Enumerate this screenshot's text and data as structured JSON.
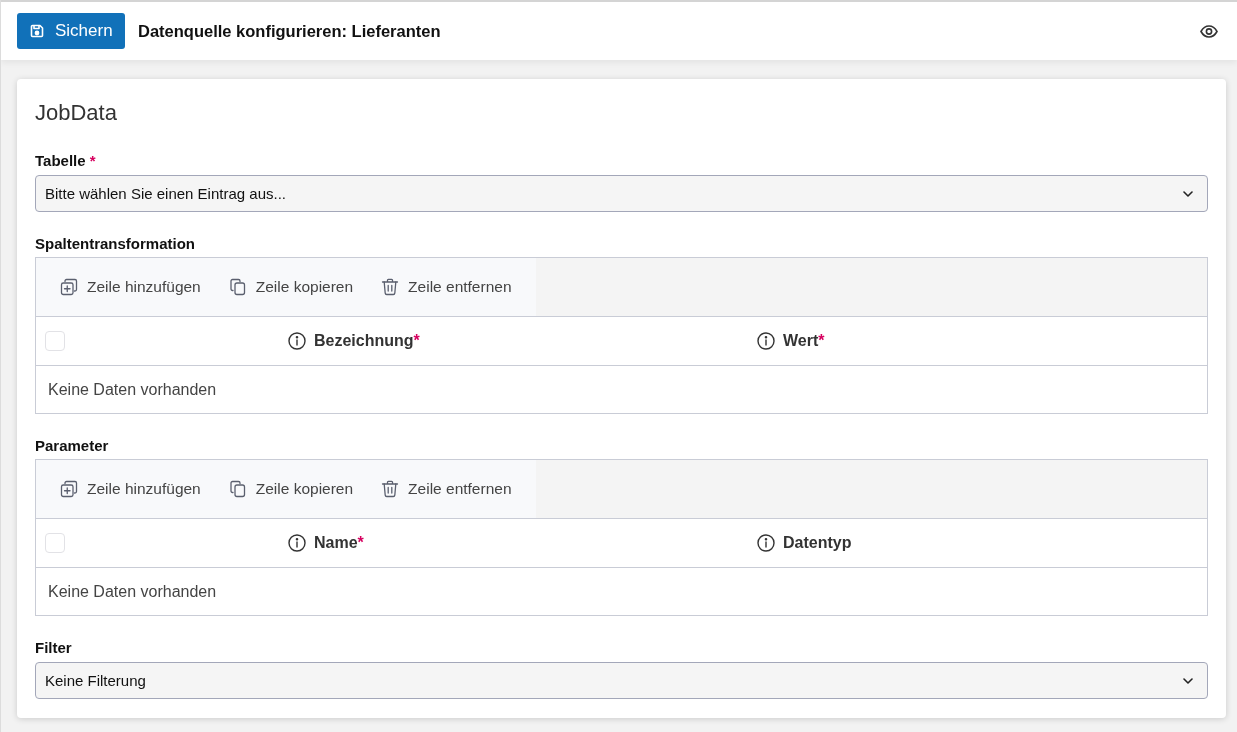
{
  "header": {
    "save_button": "Sichern",
    "title": "Datenquelle konfigurieren: Lieferanten"
  },
  "card": {
    "title": "JobData",
    "sections": [
      {
        "kind": "select",
        "label": "Tabelle",
        "required_mark": "*",
        "value": "Bitte wählen Sie einen Eintrag aus..."
      },
      {
        "kind": "grid",
        "label": "Spaltentransformation",
        "actions": [
          {
            "kind": "add",
            "label": "Zeile hinzufügen"
          },
          {
            "kind": "copy",
            "label": "Zeile kopieren"
          },
          {
            "kind": "delete",
            "label": "Zeile entfernen"
          }
        ],
        "select_all_checked": false,
        "columns": [
          {
            "label": "Bezeichnung",
            "required_mark": "*"
          },
          {
            "label": "Wert",
            "required_mark": "*"
          }
        ],
        "empty_text": "Keine Daten vorhanden"
      },
      {
        "kind": "grid",
        "label": "Parameter",
        "actions": [
          {
            "kind": "add",
            "label": "Zeile hinzufügen"
          },
          {
            "kind": "copy",
            "label": "Zeile kopieren"
          },
          {
            "kind": "delete",
            "label": "Zeile entfernen"
          }
        ],
        "select_all_checked": false,
        "columns": [
          {
            "label": "Name",
            "required_mark": "*"
          },
          {
            "label": "Datentyp"
          }
        ],
        "empty_text": "Keine Daten vorhanden"
      },
      {
        "kind": "select",
        "label": "Filter",
        "value": "Keine Filterung"
      }
    ]
  }
}
